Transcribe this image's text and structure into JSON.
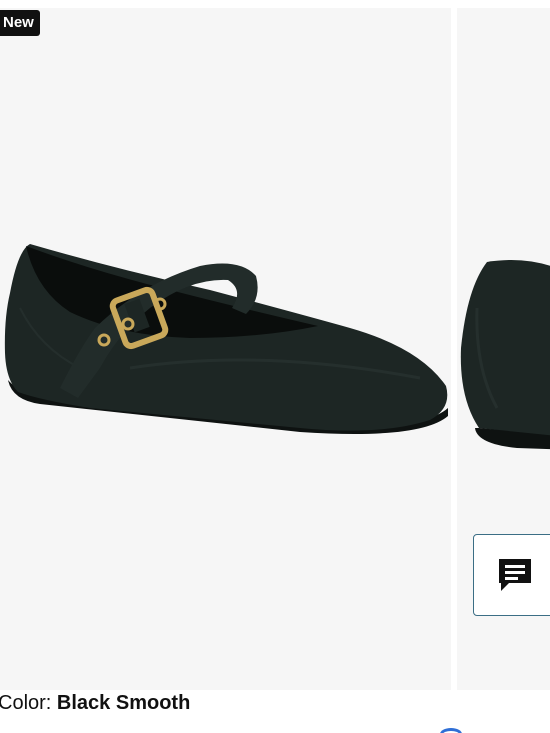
{
  "product": {
    "badge": "New",
    "color_label": "Color:",
    "color_value": "Black Smooth"
  },
  "gallery": {
    "images": [
      {
        "icon": "mary-jane-flat-shoe-image",
        "view": "three-quarter side"
      },
      {
        "icon": "shoe-heel-image",
        "view": "back"
      }
    ]
  },
  "chat": {
    "icon": "chat-icon"
  },
  "colors": {
    "shoe": "#1d2624",
    "buckle": "#c9a85a",
    "accent": "#3b6e85",
    "selected_swatch": "#2f6fd6"
  }
}
